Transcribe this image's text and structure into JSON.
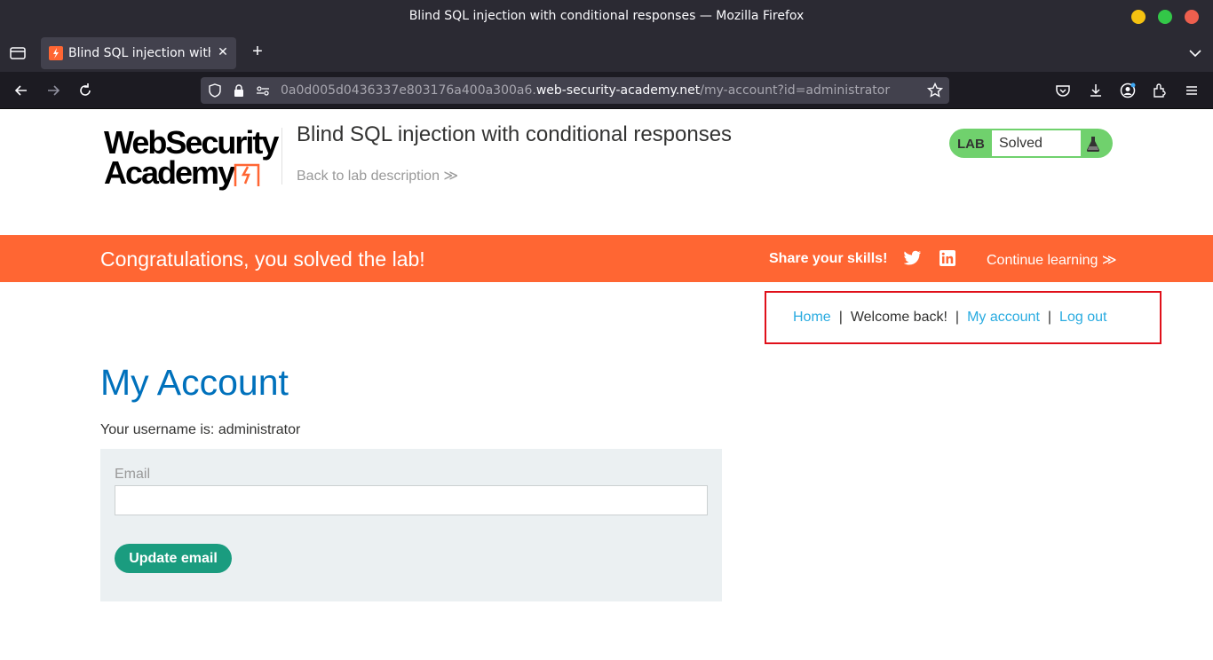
{
  "window": {
    "title": "Blind SQL injection with conditional responses — Mozilla Firefox"
  },
  "tab": {
    "title": "Blind SQL injection with c",
    "favicon": "lightning-favicon"
  },
  "address_bar": {
    "url_prefix": "0a0d005d0436337e803176a400a300a6.",
    "url_host": "web-security-academy.net",
    "url_path": "/my-account?id=administrator"
  },
  "header": {
    "logo_line1": "WebSecurity",
    "logo_line2": "Academy",
    "lab_title": "Blind SQL injection with conditional responses",
    "back_link": "Back to lab description ≫",
    "lab_badge_label": "LAB",
    "lab_status": "Solved"
  },
  "banner": {
    "message": "Congratulations, you solved the lab!",
    "share_label": "Share your skills!",
    "continue_label": "Continue learning ≫",
    "color": "#ff6633"
  },
  "topnav": {
    "home": "Home",
    "sep1": "|",
    "welcome": "Welcome back!",
    "sep2": "|",
    "my_account": "My account",
    "sep3": "|",
    "log_out": "Log out"
  },
  "main": {
    "heading": "My Account",
    "username_line": "Your username is: administrator",
    "email_label": "Email",
    "email_value": "",
    "update_button": "Update email"
  },
  "colors": {
    "heading": "#0071bc",
    "link": "#29abe0",
    "button": "#1a9c7f",
    "badge": "#70d16d",
    "highlight": "#e0101a"
  }
}
